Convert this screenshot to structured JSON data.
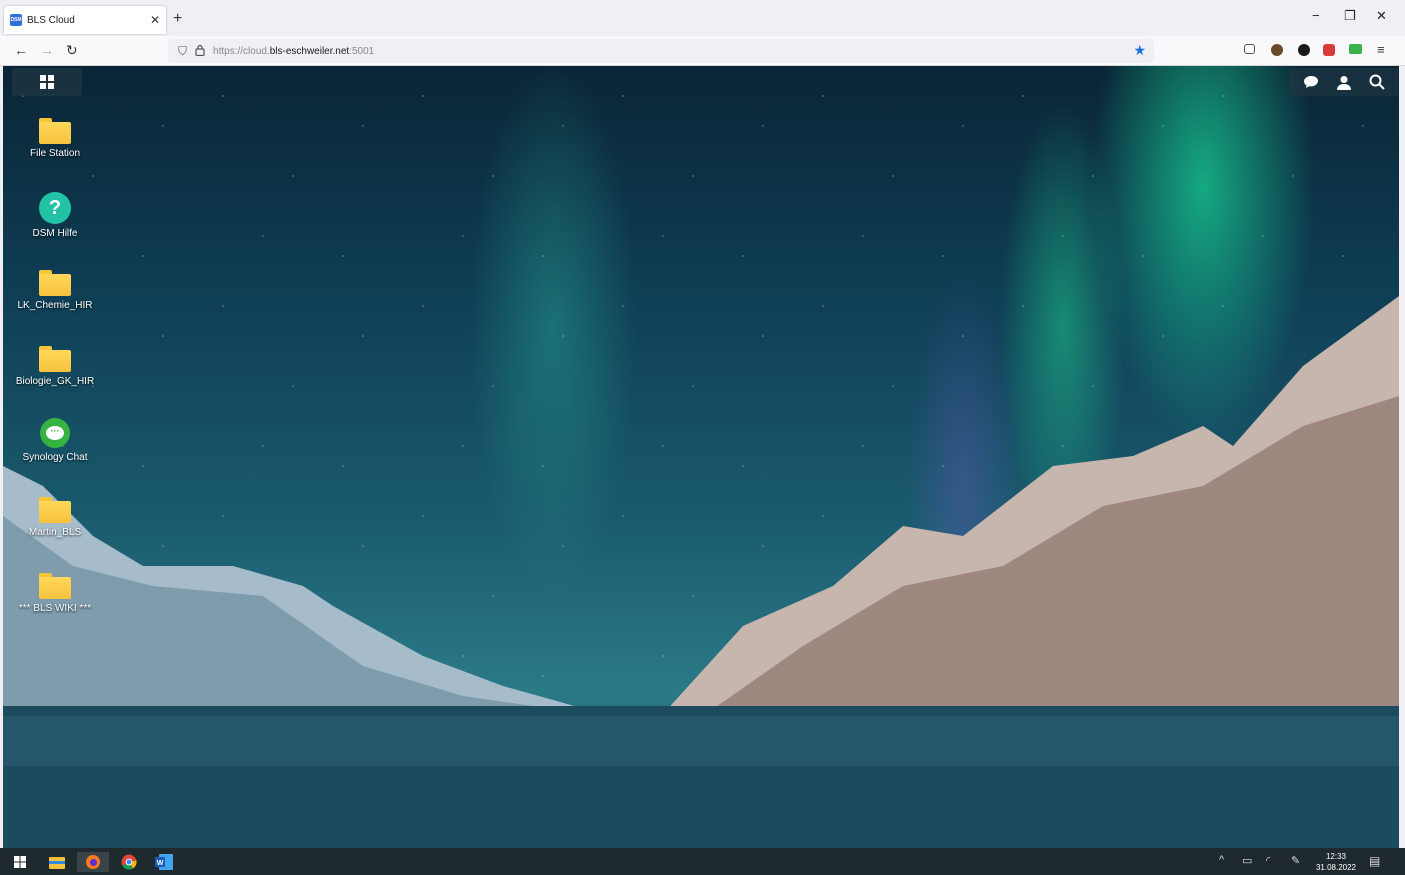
{
  "browser": {
    "tab_title": "BLS Cloud",
    "favicon_text": "DSM",
    "new_tab_label": "+",
    "url_scheme": "https://cloud.",
    "url_host": "bls-eschweiler.net",
    "url_port": ":5001"
  },
  "desktop_icons": [
    {
      "label": "File Station",
      "icon": "folder-icon"
    },
    {
      "label": "DSM Hilfe",
      "icon": "help-icon"
    },
    {
      "label": "LK_Chemie_HIR",
      "icon": "folder-icon"
    },
    {
      "label": "Biologie_GK_HIR",
      "icon": "folder-icon"
    },
    {
      "label": "Synology Chat",
      "icon": "chat-icon"
    },
    {
      "label": "Martin_BLS",
      "icon": "folder-icon"
    },
    {
      "label": "*** BLS WIKI ***",
      "icon": "folder-icon"
    }
  ],
  "taskbar": {
    "time": "12:33",
    "date": "31.08.2022",
    "apps": [
      "start-icon",
      "file-explorer-icon",
      "firefox-icon",
      "chrome-icon",
      "word-icon"
    ]
  },
  "colors": {
    "accent": "#1d6fe0",
    "folder": "#f7c23c",
    "help": "#22c3a5",
    "chat": "#36b340",
    "taskbar": "#1f2a2e"
  }
}
